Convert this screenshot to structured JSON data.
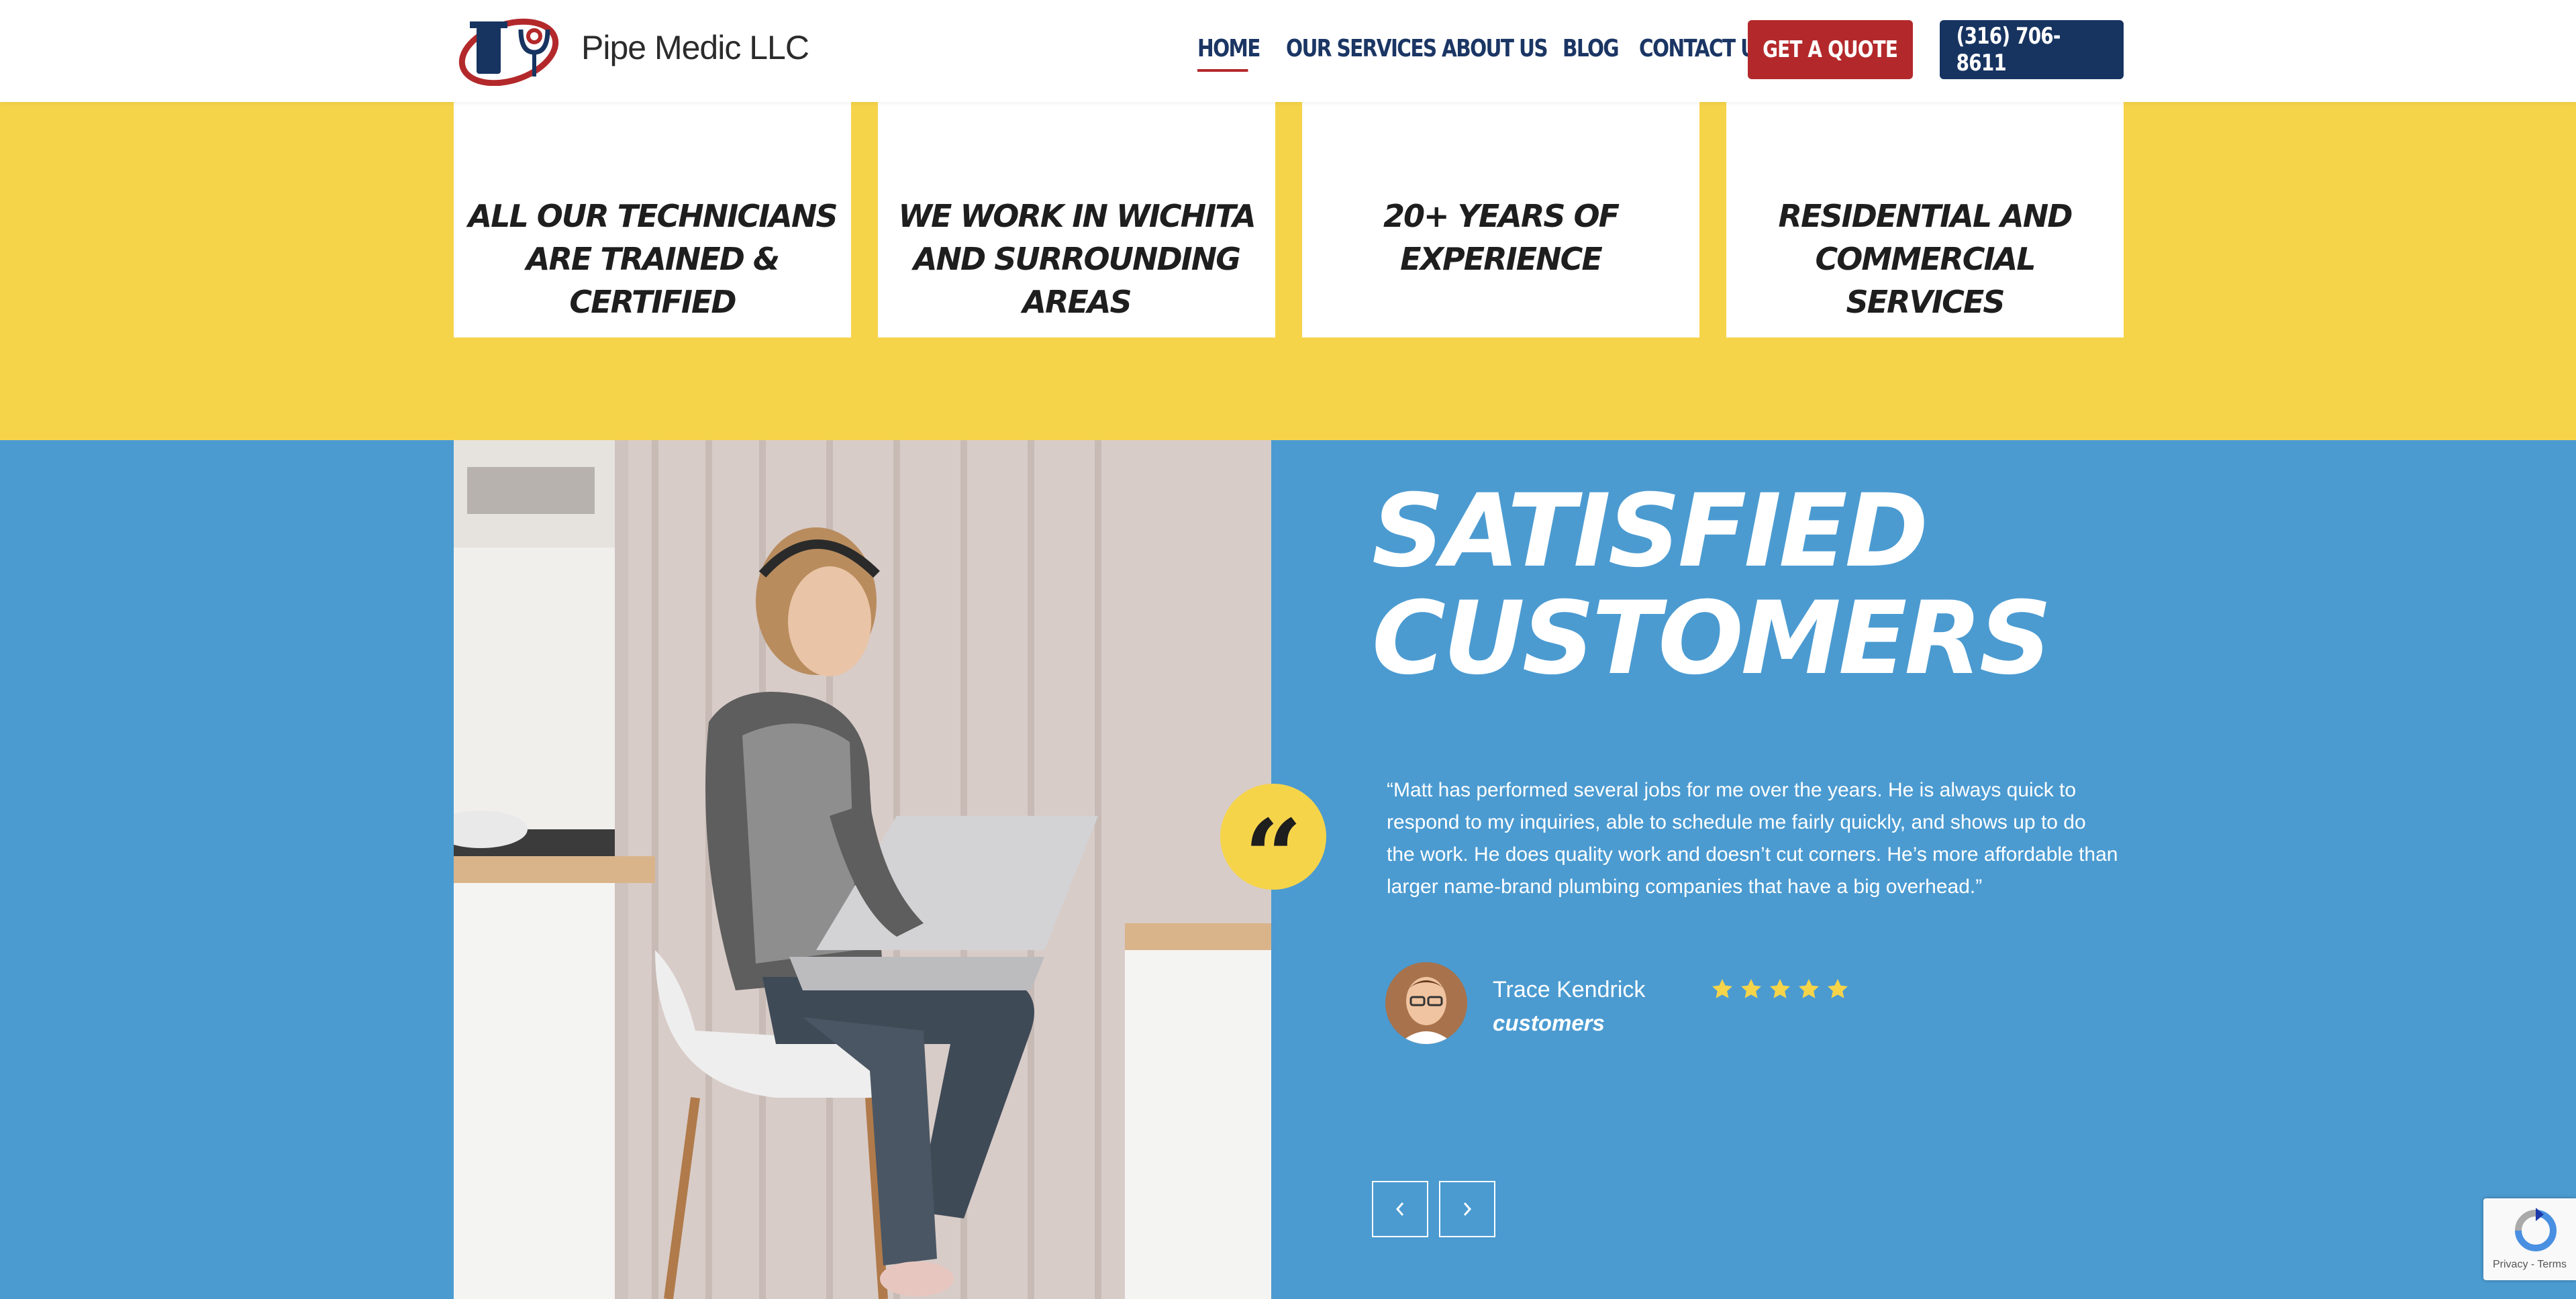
{
  "header": {
    "logo_text": "Pipe Medic LLC",
    "nav": [
      {
        "label": "HOME",
        "active": true
      },
      {
        "label": "OUR SERVICES",
        "active": false
      },
      {
        "label": "ABOUT US",
        "active": false
      },
      {
        "label": "BLOG",
        "active": false
      },
      {
        "label": "CONTACT US",
        "active": false
      }
    ],
    "quote_button": "GET A QUOTE",
    "phone_button": "(316) 706-8611"
  },
  "features": [
    {
      "title": "ALL OUR TECHNICIANS ARE TRAINED & CERTIFIED",
      "icon": "thermometer-icon"
    },
    {
      "title": "WE WORK IN WICHITA AND SURROUNDING AREAS",
      "icon": "globe-icon"
    },
    {
      "title": "20+ YEARS OF EXPERIENCE",
      "icon": "faucet-icon"
    },
    {
      "title": "RESIDENTIAL AND COMMERCIAL SERVICES",
      "icon": "building-icon"
    }
  ],
  "testimonials": {
    "title_line1": "SATISFIED",
    "title_line2": "CUSTOMERS",
    "quote_mark": "“",
    "quote": "“Matt has performed several jobs for me over the years. He is always quick to respond to my inquiries, able to schedule me fairly quickly, and shows up to do the work. He does quality work and doesn’t cut corners. He’s more affordable than larger name-brand plumbing companies that have a big overhead.”",
    "reviewer_name": "Trace Kendrick",
    "reviewer_role": "customers",
    "rating": 5,
    "prev_icon": "chevron-left-icon",
    "next_icon": "chevron-right-icon"
  },
  "recaptcha": {
    "links": "Privacy - Terms"
  },
  "colors": {
    "yellow": "#f6d44a",
    "blue_bg": "#4b9bd1",
    "brand_red": "#b3292b",
    "brand_navy": "#173461",
    "star": "#f6d44a"
  }
}
